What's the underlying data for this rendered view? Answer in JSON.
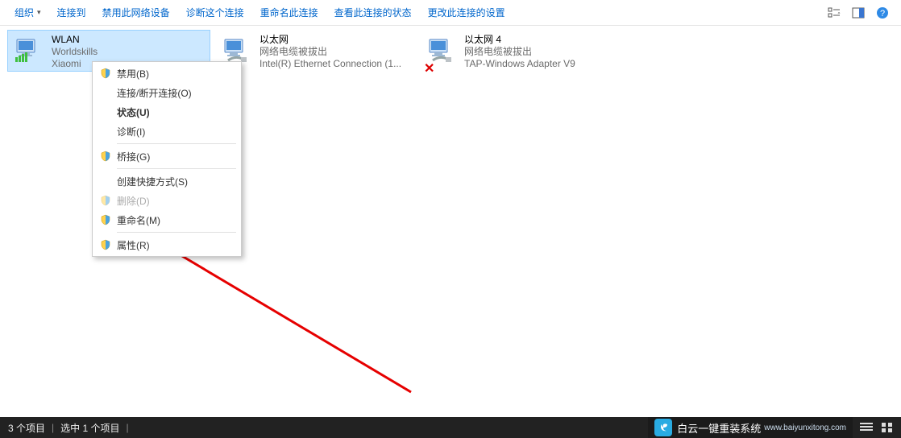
{
  "toolbar": {
    "organize": "组织",
    "connect_to": "连接到",
    "disable_device": "禁用此网络设备",
    "diagnose": "诊断这个连接",
    "rename": "重命名此连接",
    "view_status": "查看此连接的状态",
    "change_settings": "更改此连接的设置"
  },
  "adapters": [
    {
      "name": "WLAN",
      "line2": "Worldskills",
      "line3": "Xiaomi"
    },
    {
      "name": "以太网",
      "line2": "网络电缆被拔出",
      "line3": "Intel(R) Ethernet Connection (1..."
    },
    {
      "name": "以太网 4",
      "line2": "网络电缆被拔出",
      "line3": "TAP-Windows Adapter V9"
    }
  ],
  "context_menu": {
    "disable": "禁用(B)",
    "connect": "连接/断开连接(O)",
    "status": "状态(U)",
    "diagnose": "诊断(I)",
    "bridge": "桥接(G)",
    "shortcut": "创建快捷方式(S)",
    "delete": "删除(D)",
    "rename": "重命名(M)",
    "properties": "属性(R)"
  },
  "status_bar": {
    "items": "3 个项目",
    "selected": "选中 1 个项目"
  },
  "watermark": {
    "brand": "白云一键重装系统",
    "url": "www.baiyunxitong.com"
  }
}
